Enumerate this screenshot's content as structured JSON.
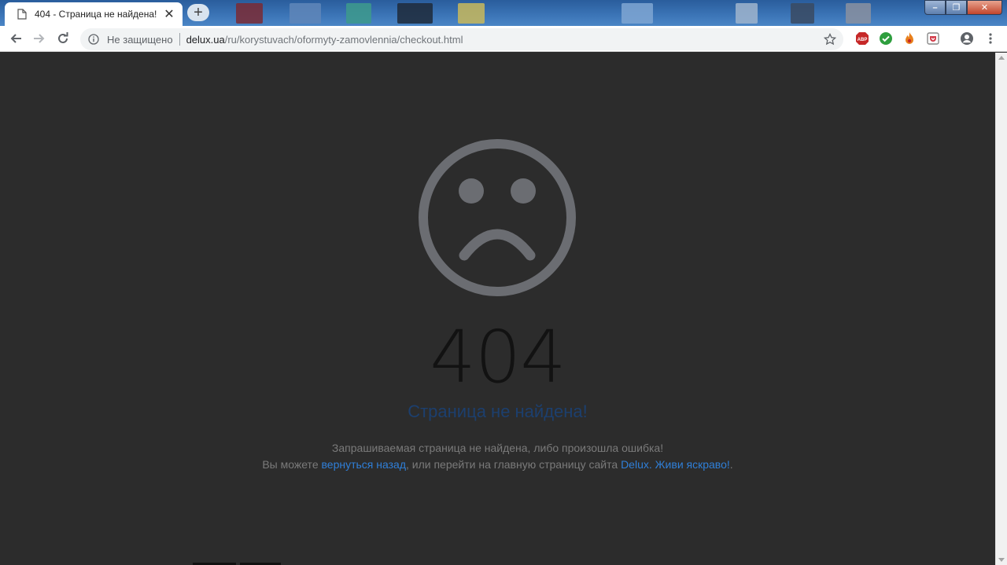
{
  "browser": {
    "tab": {
      "title": "404 - Страница не найдена!",
      "close_glyph": "✕"
    },
    "new_tab_glyph": "+",
    "window_controls": {
      "minimize": "–",
      "restore": "❐",
      "close": "✕"
    },
    "omnibox": {
      "security_label": "Не защищено",
      "url_domain": "delux.ua",
      "url_path": "/ru/korystuvach/oformyty-zamovlennia/checkout.html"
    },
    "extensions": [
      {
        "name": "adblock-icon",
        "label": "ABP",
        "color": "#c62828"
      },
      {
        "name": "check-extension-icon",
        "color": "#2e9e3e"
      },
      {
        "name": "fire-extension-icon",
        "color": "#e8801c"
      },
      {
        "name": "pocket-extension-icon",
        "color": "#d23c4a"
      }
    ]
  },
  "page": {
    "code": "404",
    "title": "Страница не найдена!",
    "message_line1": "Запрашиваемая страница не найдена, либо произошла ошибка!",
    "message_line2_prefix": "Вы можете ",
    "back_link": "вернуться назад",
    "message_line2_middle": ", или перейти на главную страницу сайта ",
    "home_link": "Delux. Живи яскраво!",
    "message_line2_suffix": "."
  },
  "colors": {
    "page_bg": "#2c2c2c",
    "face": "#6b6d72",
    "link": "#2f7fd8",
    "title": "#1c3f6e"
  }
}
